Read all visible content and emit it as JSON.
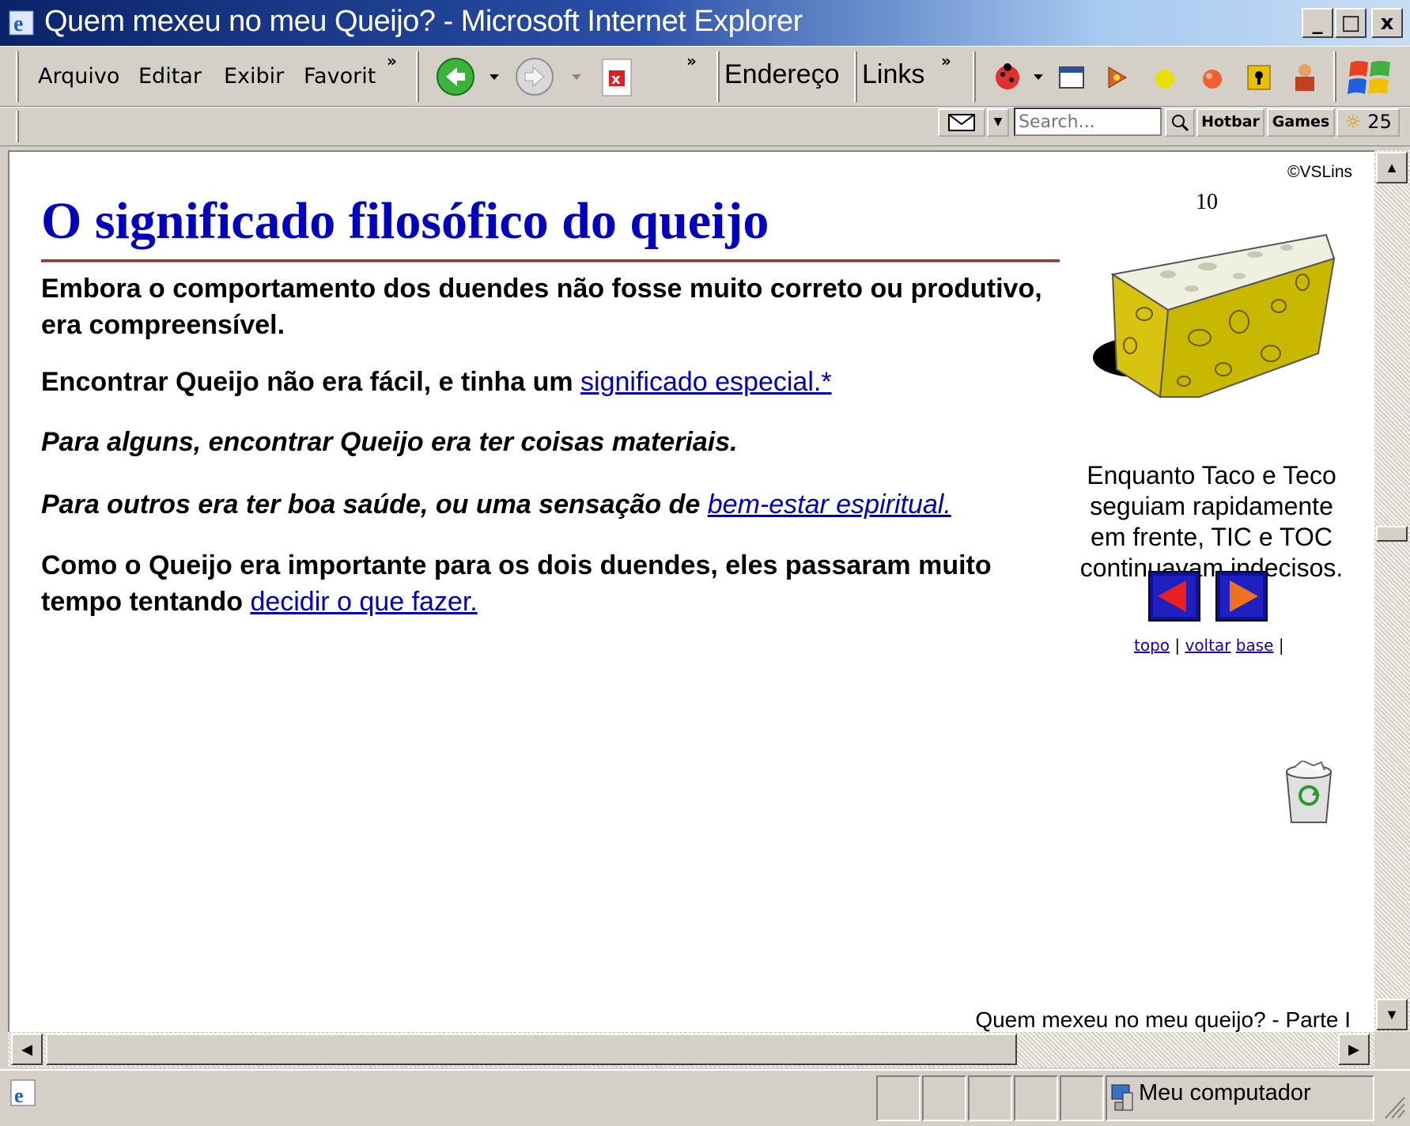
{
  "window": {
    "title": "Quem mexeu no meu Queijo? - Microsoft Internet Explorer",
    "controls": {
      "minimize": "_",
      "maximize": "□",
      "close": "x"
    }
  },
  "menubar": {
    "items": [
      "Arquivo",
      "Editar",
      "Exibir",
      "Favorit"
    ],
    "more": "»"
  },
  "toolbar": {
    "address_label": "Endereço",
    "links_label": "Links",
    "more": "»"
  },
  "searchbar": {
    "placeholder": "Search...",
    "hotbar_label": "Hotbar",
    "games_label": "Games",
    "weather_value": "25"
  },
  "page": {
    "copyright": "©VSLins",
    "page_number": "10",
    "heading": "O significado filosófico do queijo",
    "paragraphs": {
      "p1": "Embora o comportamento dos duendes não fosse muito correto ou produtivo, era compreensível.",
      "p2_text": "Encontrar Queijo não era fácil, e tinha um ",
      "p2_link": "significado especial.*",
      "p3": "Para alguns, encontrar Queijo era ter coisas materiais.",
      "p4_text": "Para outros era ter boa saúde, ou uma sensação de ",
      "p4_link": "bem-estar espiritual.",
      "p5_text": "Como o Queijo era importante para os dois duendes, eles passaram muito tempo tentando ",
      "p5_link": "decidir o que fazer."
    },
    "caption": "Enquanto Taco e Teco seguiam rapidamente em frente, TIC e TOC continuavam indecisos.",
    "nav": {
      "top": "topo",
      "back": "voltar",
      "bottom": "base",
      "sep": "|"
    },
    "footer": "Quem mexeu no meu queijo? - Parte I"
  },
  "statusbar": {
    "zone": "Meu computador"
  },
  "colors": {
    "heading": "#0000c0",
    "link": "#0000c0",
    "rule": "#8b3a3a",
    "titlebar_start": "#0a246a",
    "titlebar_end": "#c8dcf4"
  }
}
